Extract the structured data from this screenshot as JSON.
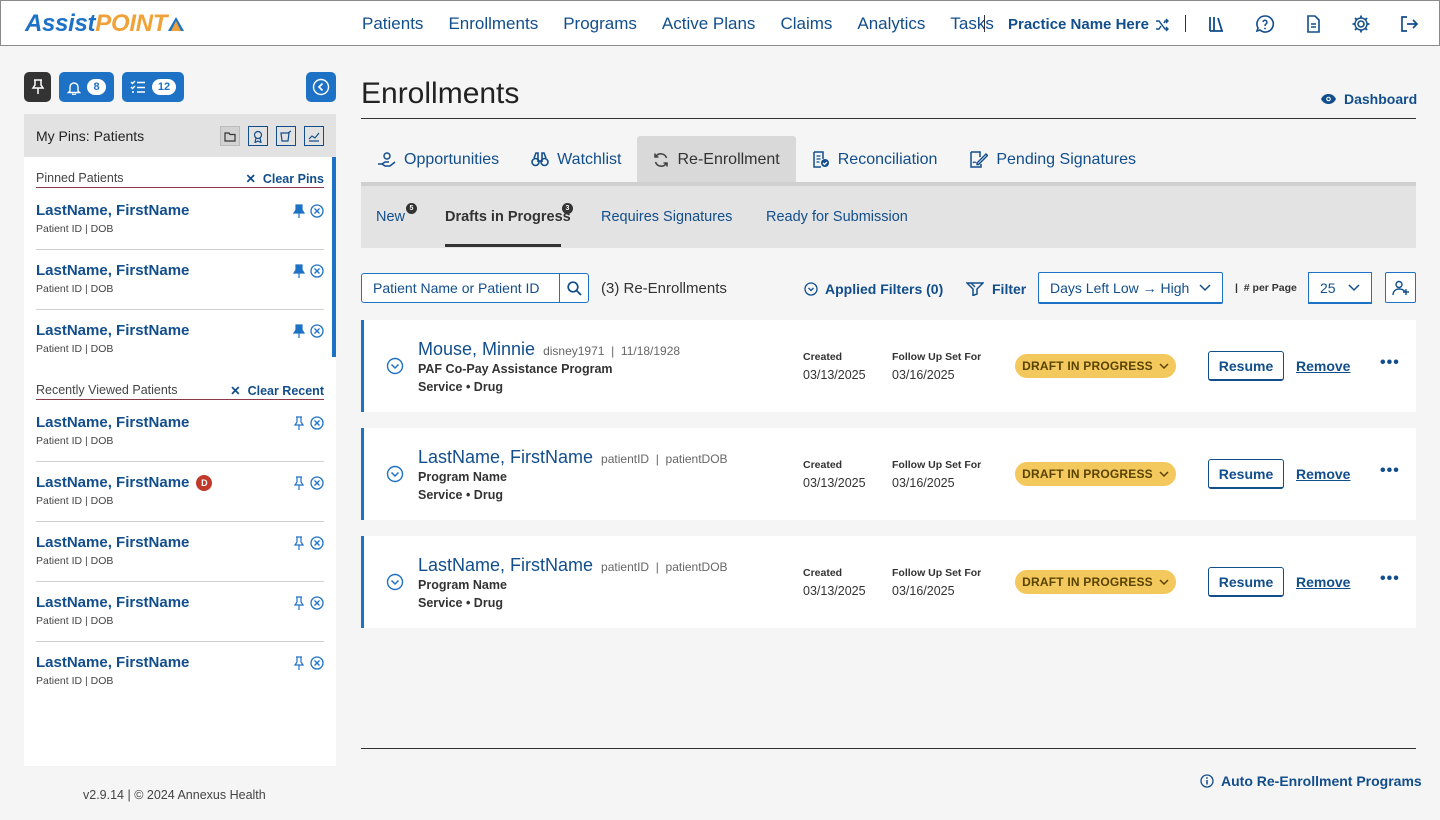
{
  "app": {
    "logo_part1": "Assist",
    "logo_part2": "POINT"
  },
  "nav": {
    "items": [
      "Patients",
      "Enrollments",
      "Programs",
      "Active Plans",
      "Claims",
      "Analytics",
      "Tasks"
    ],
    "practice": "Practice Name Here"
  },
  "sidebar": {
    "notifications_count": "8",
    "tasks_count": "12",
    "header": "My Pins: Patients",
    "pinned_title": "Pinned Patients",
    "clear_pins": "Clear Pins",
    "recent_title": "Recently Viewed Patients",
    "clear_recent": "Clear Recent",
    "pinned": [
      {
        "name": "LastName, FirstName",
        "sub": "Patient ID  |  DOB"
      },
      {
        "name": "LastName, FirstName",
        "sub": "Patient ID  |  DOB"
      },
      {
        "name": "LastName, FirstName",
        "sub": "Patient ID  |  DOB"
      }
    ],
    "recent": [
      {
        "name": "LastName, FirstName",
        "sub": "Patient ID  |  DOB"
      },
      {
        "name": "LastName, FirstName",
        "sub": "Patient ID  |  DOB",
        "badge": "D"
      },
      {
        "name": "LastName, FirstName",
        "sub": "Patient ID  |  DOB"
      },
      {
        "name": "LastName, FirstName",
        "sub": "Patient ID  |  DOB"
      },
      {
        "name": "LastName, FirstName",
        "sub": "Patient ID  |  DOB"
      }
    ],
    "version": "v2.9.14  |  © 2024 Annexus Health"
  },
  "page": {
    "title": "Enrollments",
    "dashboard": "Dashboard"
  },
  "tabs": [
    "Opportunities",
    "Watchlist",
    "Re-Enrollment",
    "Reconciliation",
    "Pending Signatures"
  ],
  "subtabs": {
    "new": "New",
    "new_count": "5",
    "drafts": "Drafts in Progress",
    "drafts_count": "3",
    "requires": "Requires Signatures",
    "ready": "Ready for Submission"
  },
  "toolbar": {
    "search_placeholder": "Patient Name or Patient ID",
    "count": "(3) Re-Enrollments",
    "applied_filters": "Applied Filters (0)",
    "filter": "Filter",
    "sort": "Days Left Low → High",
    "per_page_label": "# per Page",
    "per_page": "25"
  },
  "records": [
    {
      "name": "Mouse, Minnie",
      "id": "disney1971",
      "dob": "11/18/1928",
      "program": "PAF Co-Pay Assistance Program",
      "service": "Service  •  Drug",
      "created_label": "Created",
      "created": "03/13/2025",
      "follow_label": "Follow Up Set For",
      "follow": "03/16/2025",
      "status": "DRAFT IN PROGRESS",
      "resume": "Resume",
      "remove": "Remove",
      "more": "•••"
    },
    {
      "name": "LastName, FirstName",
      "id": "patientID",
      "dob": "patientDOB",
      "program": "Program Name",
      "service": "Service  •  Drug",
      "created_label": "Created",
      "created": "03/13/2025",
      "follow_label": "Follow Up Set For",
      "follow": "03/16/2025",
      "status": "DRAFT IN PROGRESS",
      "resume": "Resume",
      "remove": "Remove",
      "more": "•••"
    },
    {
      "name": "LastName, FirstName",
      "id": "patientID",
      "dob": "patientDOB",
      "program": "Program Name",
      "service": "Service  •  Drug",
      "created_label": "Created",
      "created": "03/13/2025",
      "follow_label": "Follow Up Set For",
      "follow": "03/16/2025",
      "status": "DRAFT IN PROGRESS",
      "resume": "Resume",
      "remove": "Remove",
      "more": "•••"
    }
  ],
  "footer": {
    "auto": "Auto Re-Enrollment Programs"
  },
  "colors": {
    "brand_blue": "#1e72c6",
    "brand_orange": "#f0a23a",
    "status_yellow": "#f3c85c",
    "link": "#124e8c"
  }
}
